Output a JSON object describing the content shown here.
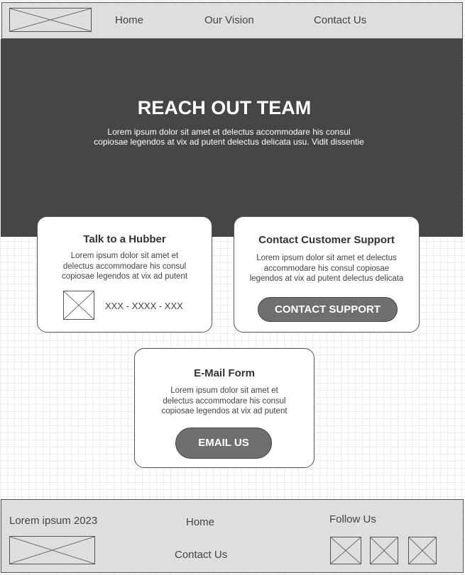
{
  "header": {
    "logo": "logo-placeholder-icon",
    "nav": [
      "Home",
      "Our Vision",
      "Contact Us"
    ]
  },
  "hero": {
    "title": "REACH OUT TEAM",
    "text_line1": "Lorem ipsum dolor sit amet et delectus accommodare his consul",
    "text_line2": "copiosae legendos at vix ad putent delectus delicata usu. Vidit dissentie"
  },
  "hubber_card": {
    "title": "Talk to a Hubber",
    "text_line1": "Lorem ipsum dolor sit amet et",
    "text_line2": "delectus accommodare his consul",
    "text_line3": "copiosae legendos at vix ad putent",
    "image": "image-placeholder-icon",
    "phone": "XXX - XXXX - XXX"
  },
  "support_card": {
    "title": "Contact Customer Support",
    "text_line1": "Lorem ipsum dolor sit amet et delectus",
    "text_line2": "accommodare his consul copiosae",
    "text_line3": "legendos at vix ad putent delectus delicata",
    "button": "CONTACT SUPPORT"
  },
  "email_card": {
    "title": "E-Mail Form",
    "text_line1": "Lorem ipsum dolor sit amet et",
    "text_line2": "delectus accommodare his consul",
    "text_line3": "copiosae legendos at vix ad putent",
    "button": "EMAIL US"
  },
  "footer": {
    "copyright": "Lorem ipsum 2023",
    "links": [
      "Home",
      "Contact Us"
    ],
    "follow": "Follow Us",
    "social_icons": [
      "social-placeholder-icon",
      "social-placeholder-icon",
      "social-placeholder-icon"
    ]
  },
  "colors": {
    "hero_bg": "#464646",
    "button_bg": "#6f6f6f",
    "bar_bg": "#dedede"
  }
}
